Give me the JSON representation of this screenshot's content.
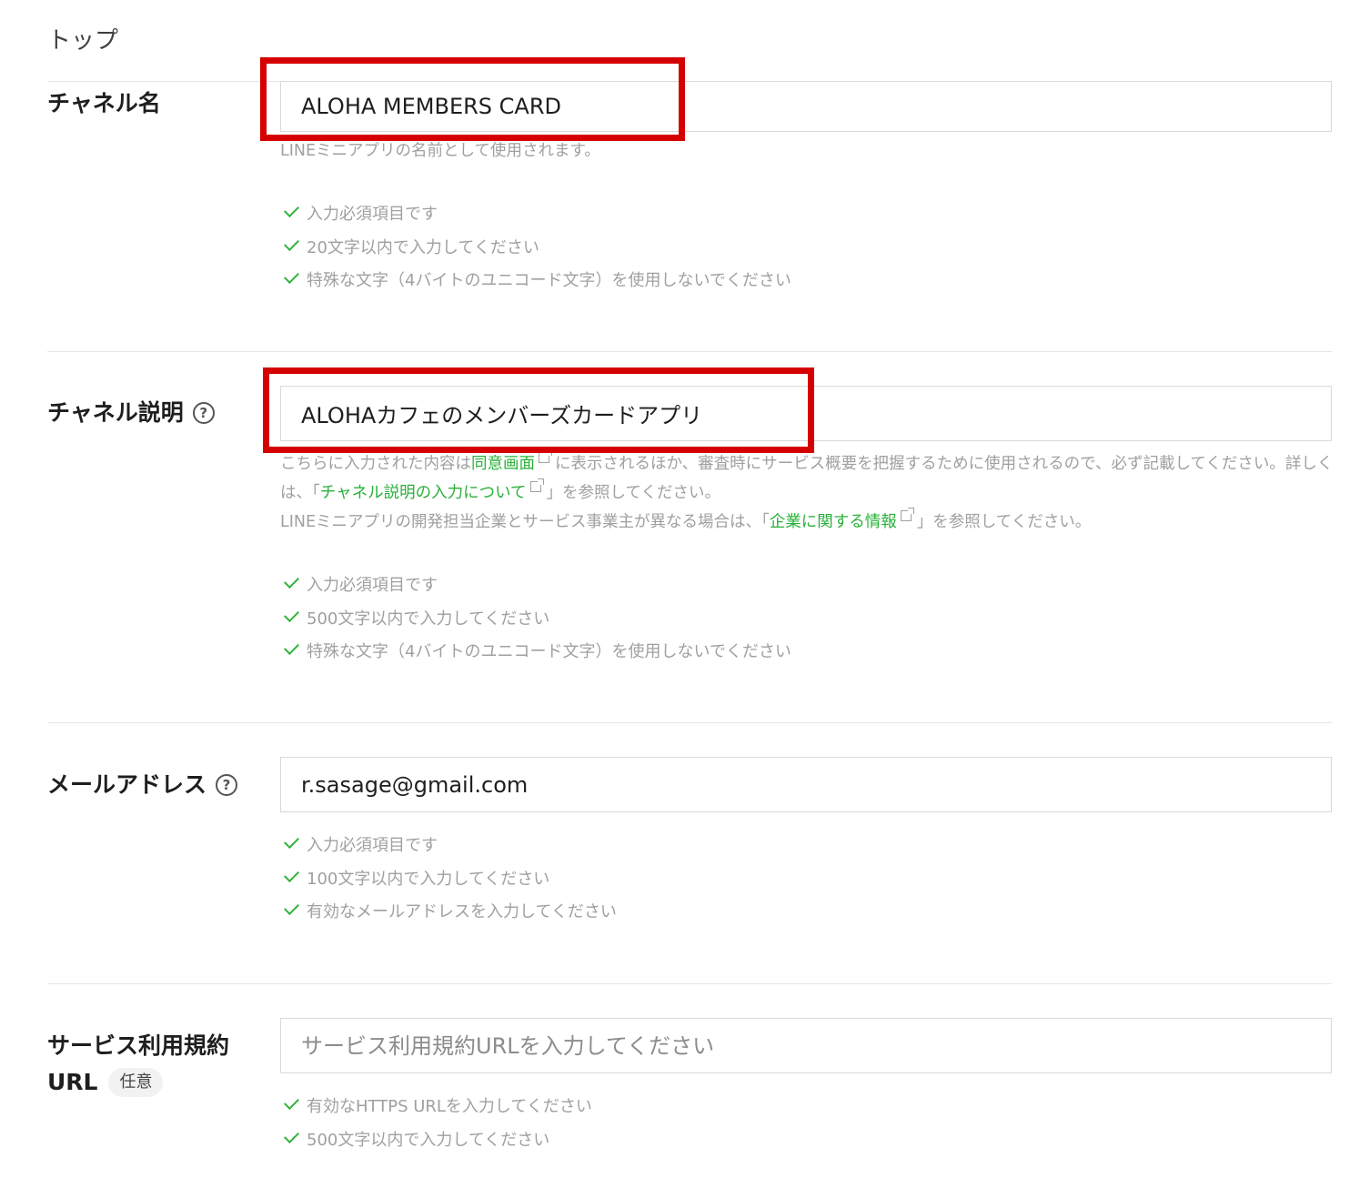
{
  "breadcrumb": "トップ",
  "channel_name": {
    "label": "チャネル名",
    "value": "ALOHA MEMBERS CARD",
    "note": "LINEミニアプリの名前として使用されます。",
    "rules": [
      "入力必須項目です",
      "20文字以内で入力してください",
      "特殊な文字（4バイトのユニコード文字）を使用しないでください"
    ]
  },
  "channel_description": {
    "label": "チャネル説明",
    "help": "?",
    "value": "ALOHAカフェのメンバーズカードアプリ",
    "note": {
      "part1": "こちらに入力された内容は",
      "link1": "同意画面",
      "part2": "に表示されるほか、審査時にサービス概要を把握するために使用されるので、必ず記載してください。詳しくは、「",
      "link2": "チャネル説明の入力について",
      "part3": "」を参照してください。",
      "part4": "LINEミニアプリの開発担当企業とサービス事業主が異なる場合は、「",
      "link3": "企業に関する情報",
      "part5": "」を参照してください。"
    },
    "rules": [
      "入力必須項目です",
      "500文字以内で入力してください",
      "特殊な文字（4バイトのユニコード文字）を使用しないでください"
    ]
  },
  "email": {
    "label": "メールアドレス",
    "help": "?",
    "value": "r.sasage@gmail.com",
    "rules": [
      "入力必須項目です",
      "100文字以内で入力してください",
      "有効なメールアドレスを入力してください"
    ]
  },
  "terms_url": {
    "label_line1": "サービス利用規約",
    "label_line2": "URL",
    "optional_badge": "任意",
    "placeholder": "サービス利用規約URLを入力してください",
    "rules": [
      "有効なHTTPS URLを入力してください",
      "500文字以内で入力してください"
    ]
  },
  "colors": {
    "highlight": "#d50000",
    "link": "#2ab03a",
    "check": "#2fb33a"
  }
}
